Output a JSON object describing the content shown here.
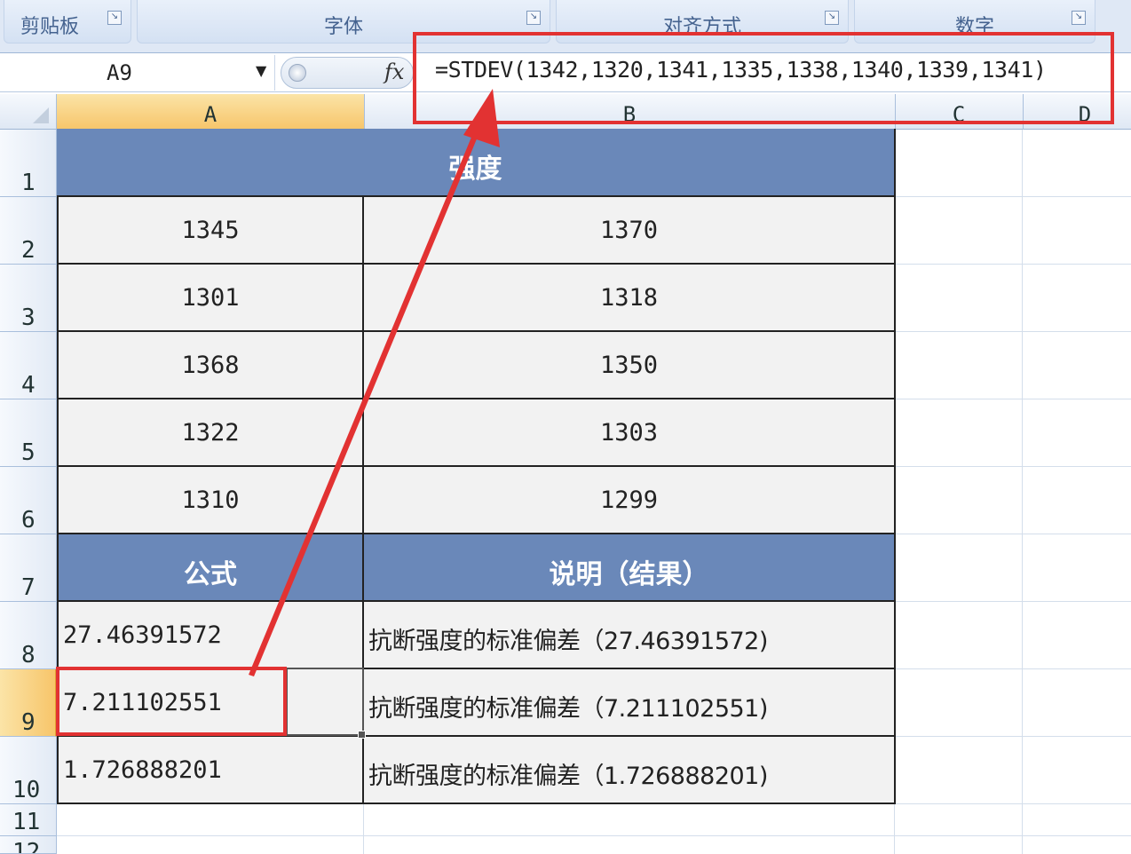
{
  "ribbon": {
    "groups": [
      {
        "label": "剪贴板"
      },
      {
        "label": "字体"
      },
      {
        "label": "对齐方式"
      },
      {
        "label": "数字"
      }
    ]
  },
  "formula_bar": {
    "name_box": "A9",
    "fx_label": "fx",
    "formula": "=STDEV(1342,1320,1341,1335,1338,1340,1339,1341)"
  },
  "columns": [
    "A",
    "B",
    "C",
    "D"
  ],
  "rows": [
    "1",
    "2",
    "3",
    "4",
    "5",
    "6",
    "7",
    "8",
    "9",
    "10",
    "11",
    "12"
  ],
  "sheet": {
    "title": "强度",
    "data_rows": [
      {
        "a": "1345",
        "b": "1370"
      },
      {
        "a": "1301",
        "b": "1318"
      },
      {
        "a": "1368",
        "b": "1350"
      },
      {
        "a": "1322",
        "b": "1303"
      },
      {
        "a": "1310",
        "b": "1299"
      }
    ],
    "formula_header": {
      "a": "公式",
      "b": "说明（结果）"
    },
    "result_rows": [
      {
        "a": "27.46391572",
        "b": "抗断强度的标准偏差（27.46391572)"
      },
      {
        "a": "7.211102551",
        "b": "抗断强度的标准偏差（7.211102551)"
      },
      {
        "a": "1.726888201",
        "b": "抗断强度的标准偏差（1.726888201)"
      }
    ]
  },
  "colors": {
    "header_fill": "#6a88b9",
    "cell_fill": "#f2f2f2",
    "highlight": "#e23232",
    "active_header": "#f7c56a"
  }
}
